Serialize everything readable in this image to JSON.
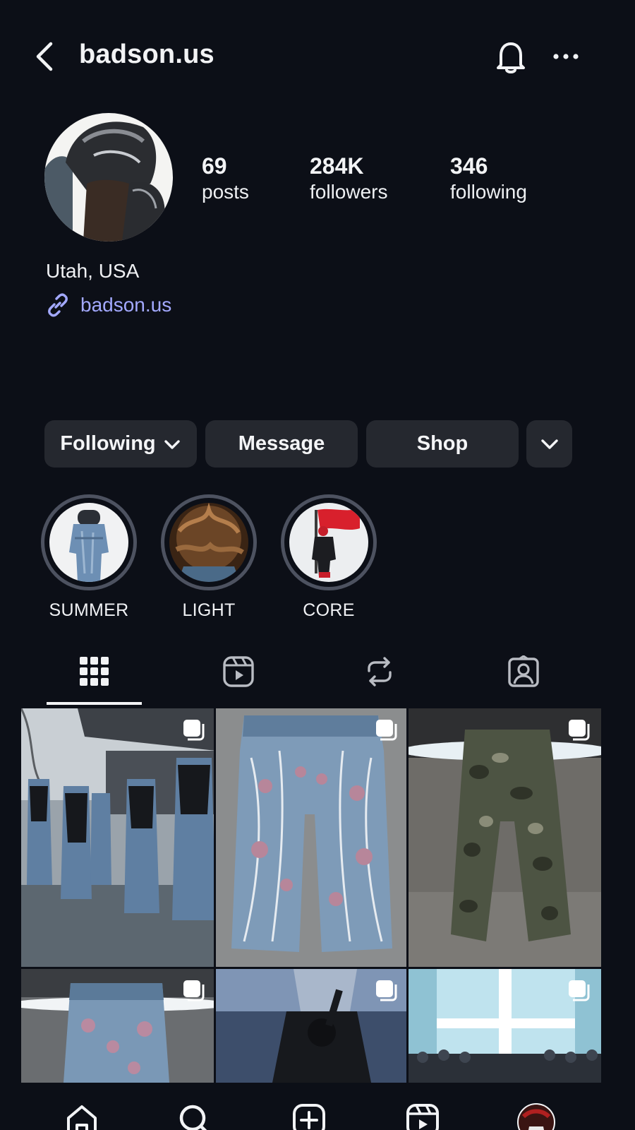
{
  "header": {
    "username": "badson.us"
  },
  "profile": {
    "stats": [
      {
        "value": "69",
        "label": "posts"
      },
      {
        "value": "284K",
        "label": "followers"
      },
      {
        "value": "346",
        "label": "following"
      }
    ],
    "location": "Utah, USA",
    "link": "badson.us"
  },
  "actions": {
    "following_label": "Following",
    "message_label": "Message",
    "shop_label": "Shop"
  },
  "highlights": [
    {
      "label": "SUMMER"
    },
    {
      "label": "LIGHT"
    },
    {
      "label": "CORE"
    }
  ],
  "tabs": [
    {
      "icon": "grid-icon",
      "active": true
    },
    {
      "icon": "reels-icon",
      "active": false
    },
    {
      "icon": "reposts-icon",
      "active": false
    },
    {
      "icon": "tagged-icon",
      "active": false
    }
  ],
  "nav": [
    {
      "icon": "home-icon"
    },
    {
      "icon": "search-icon"
    },
    {
      "icon": "create-icon"
    },
    {
      "icon": "reels-icon"
    },
    {
      "icon": "profile-avatar"
    }
  ],
  "colors": {
    "background": "#0c0f17",
    "button": "#25282f",
    "link": "#a3a9ff",
    "highlight_ring": "#4d5260"
  }
}
